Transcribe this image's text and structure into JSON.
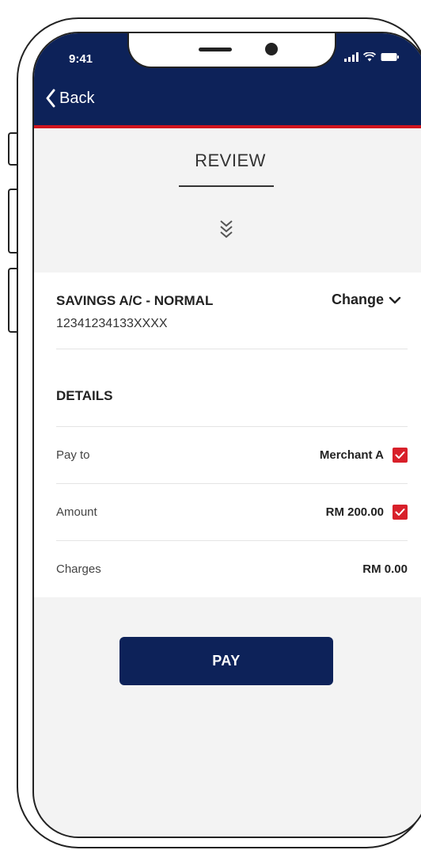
{
  "status_bar": {
    "time": "9:41"
  },
  "header": {
    "back_label": "Back"
  },
  "review": {
    "title": "REVIEW"
  },
  "account": {
    "name": "SAVINGS A/C - NORMAL",
    "number": "12341234133XXXX",
    "change_label": "Change"
  },
  "details": {
    "title": "DETAILS",
    "rows": [
      {
        "label": "Pay to",
        "value": "Merchant A",
        "checked": true
      },
      {
        "label": "Amount",
        "value": "RM 200.00",
        "checked": true
      },
      {
        "label": "Charges",
        "value": "RM 0.00",
        "checked": false
      }
    ]
  },
  "actions": {
    "pay_label": "PAY"
  },
  "colors": {
    "primary": "#0d2259",
    "accent": "#d0141e",
    "checkbox": "#d8202a",
    "background": "#f3f3f3"
  },
  "icons": {
    "back": "chevron-left-icon",
    "change": "chevron-down-icon",
    "expand": "triple-chevron-down-icon",
    "check": "check-icon"
  }
}
